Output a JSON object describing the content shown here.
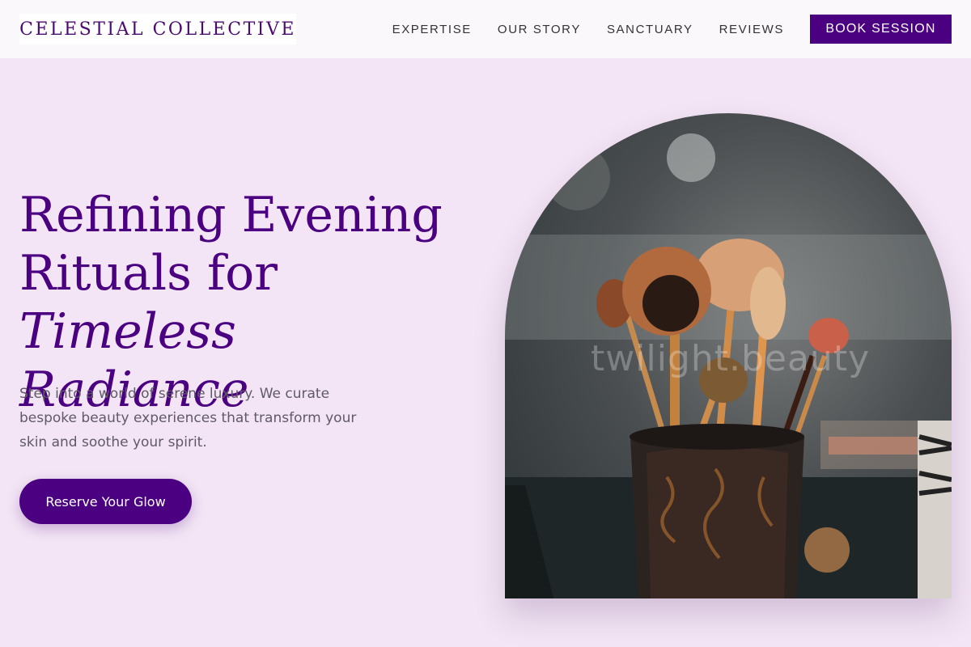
{
  "brand": {
    "name": "CELESTIAL COLLECTIVE"
  },
  "nav": {
    "links": [
      "EXPERTISE",
      "OUR STORY",
      "SANCTUARY",
      "REVIEWS"
    ],
    "cta": "BOOK SESSION"
  },
  "hero": {
    "title_line1": "Refining Evening",
    "title_line2": "Rituals for ",
    "title_italic1": "Timeless",
    "title_italic2": "Radiance",
    "subtitle": "Step into a world of serene luxury. We curate bespoke beauty experiences that transform your skin and soothe your spirit.",
    "cta": "Reserve Your Glow"
  },
  "image": {
    "watermark": "twilight.beauty",
    "description_icon": "makeup-brushes-photo"
  },
  "colors": {
    "page_bg": "#f3e5f5",
    "accent": "#4a0080",
    "nav_bg": "#fbf8fc"
  }
}
